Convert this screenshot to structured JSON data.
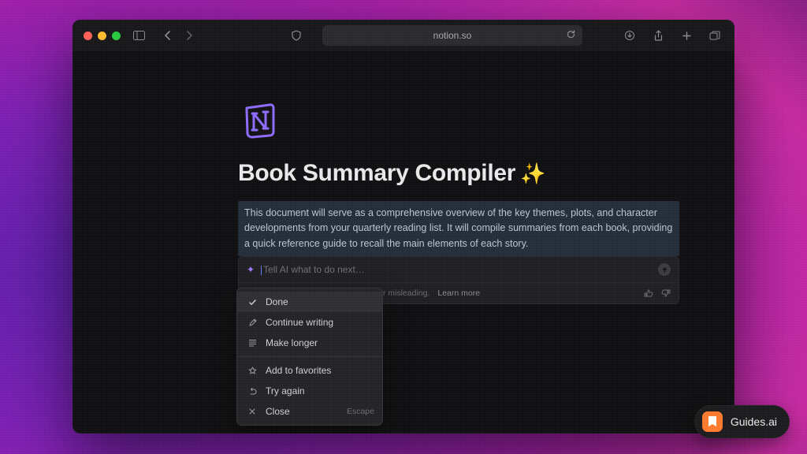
{
  "browser": {
    "url": "notion.so"
  },
  "page": {
    "title": "Book Summary Compiler",
    "title_emoji": "✨",
    "selection_text": "This document will serve as a comprehensive overview of the key themes, plots, and character developments from your quarterly reading list. It will compile summaries from each book, providing a quick reference guide to recall the main elements of each story."
  },
  "ai": {
    "placeholder": "Tell AI what to do next…",
    "disclaimer": "AI responses can be inaccurate or misleading.",
    "learn_more": "Learn more"
  },
  "menu": {
    "items": [
      {
        "icon": "check",
        "label": "Done"
      },
      {
        "icon": "pencil",
        "label": "Continue writing"
      },
      {
        "icon": "lines",
        "label": "Make longer"
      }
    ],
    "items2": [
      {
        "icon": "star",
        "label": "Add to favorites"
      },
      {
        "icon": "undo",
        "label": "Try again"
      },
      {
        "icon": "x",
        "label": "Close",
        "hint": "Escape"
      }
    ]
  },
  "badge": {
    "label": "Guides.ai"
  },
  "colors": {
    "accent_purple": "#8e6bff",
    "selection_bg": "#232d3a"
  }
}
